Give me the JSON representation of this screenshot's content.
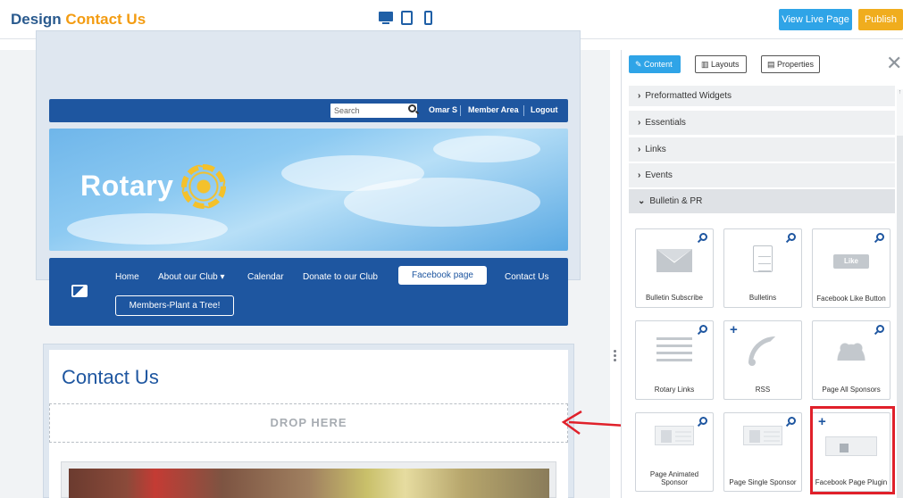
{
  "header": {
    "title_prefix": "Design",
    "title_accent": "Contact Us",
    "view_live_label": "View Live Page",
    "publish_label": "Publish",
    "device_icons": [
      "desktop-icon",
      "tablet-icon",
      "phone-icon"
    ]
  },
  "site": {
    "search_placeholder": "Search",
    "top_links": [
      "Omar S",
      "Member Area",
      "Logout"
    ],
    "brand": "Rotary",
    "menu": [
      "Home",
      "About our Club",
      "Calendar",
      "Donate to our Club",
      "Facebook page",
      "Contact Us"
    ],
    "menu_dropdown_marker": "▾",
    "menu_secondary": "Members-Plant a Tree!",
    "page_heading": "Contact Us",
    "drop_zone": "DROP HERE"
  },
  "panel": {
    "tabs": [
      "Content",
      "Layouts",
      "Properties"
    ],
    "close_icon": "close-icon",
    "sections": [
      "Preformatted Widgets",
      "Essentials",
      "Links",
      "Events",
      "Bulletin & PR"
    ],
    "widgets": [
      {
        "label": "Bulletin Subscribe",
        "icon": "envelope-icon"
      },
      {
        "label": "Bulletins",
        "icon": "document-icon"
      },
      {
        "label": "Facebook Like Button",
        "icon": "facebook-like-icon",
        "art_text": "Like"
      },
      {
        "label": "Rotary Links",
        "icon": "list-icon"
      },
      {
        "label": "RSS",
        "icon": "rss-icon"
      },
      {
        "label": "Page All Sponsors",
        "icon": "people-icon"
      },
      {
        "label": "Page Animated Sponsor",
        "icon": "sponsor-icon"
      },
      {
        "label": "Page Single Sponsor",
        "icon": "sponsor-icon"
      },
      {
        "label": "Facebook Page Plugin",
        "icon": "facebook-plugin-icon"
      }
    ]
  },
  "colors": {
    "brand_blue": "#1e56a0",
    "accent_orange": "#f39c12",
    "button_blue": "#2fa4e7",
    "publish_yellow": "#f0ad1e",
    "highlight_red": "#e0202a"
  }
}
